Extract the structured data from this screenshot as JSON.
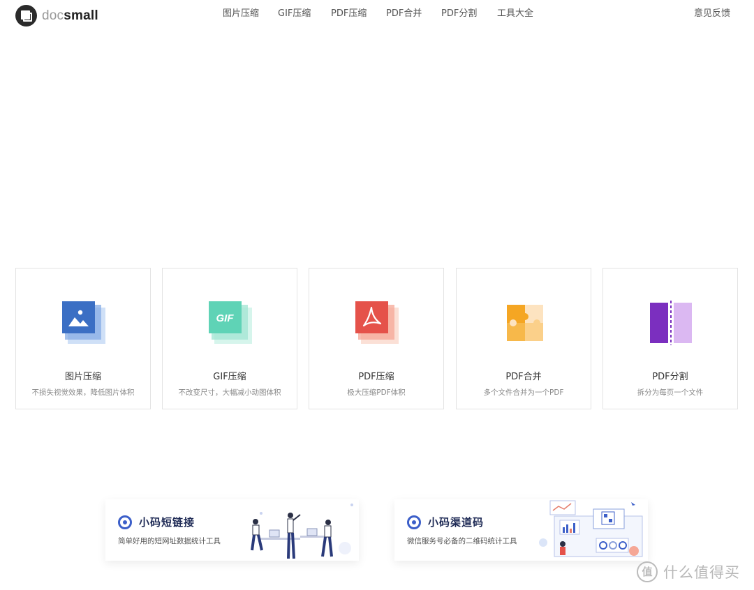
{
  "header": {
    "logo": {
      "part1": "doc",
      "part2": "small"
    },
    "nav": [
      "图片压缩",
      "GIF压缩",
      "PDF压缩",
      "PDF合并",
      "PDF分割",
      "工具大全"
    ],
    "feedback": "意见反馈"
  },
  "tools": [
    {
      "title": "图片压缩",
      "desc": "不损失视觉效果，降低图片体积",
      "icon": "image-icon",
      "color": "#3b6fc4"
    },
    {
      "title": "GIF压缩",
      "desc": "不改变尺寸，大幅减小动图体积",
      "icon": "gif-icon",
      "color": "#5fd3b6",
      "icon_text": "GIF"
    },
    {
      "title": "PDF压缩",
      "desc": "极大压缩PDF体积",
      "icon": "pdf-icon",
      "color": "#e5524a"
    },
    {
      "title": "PDF合并",
      "desc": "多个文件合并为一个PDF",
      "icon": "puzzle-icon",
      "color": "#f5a623"
    },
    {
      "title": "PDF分割",
      "desc": "拆分为每页一个文件",
      "icon": "split-icon",
      "color": "#7b2fbf"
    }
  ],
  "banners": [
    {
      "title": "小码短链接",
      "desc": "简单好用的短网址数据统计工具"
    },
    {
      "title": "小码渠道码",
      "desc": "微信服务号必备的二维码统计工具"
    }
  ],
  "watermark": {
    "text": "什么值得买",
    "icon_char": "值"
  }
}
